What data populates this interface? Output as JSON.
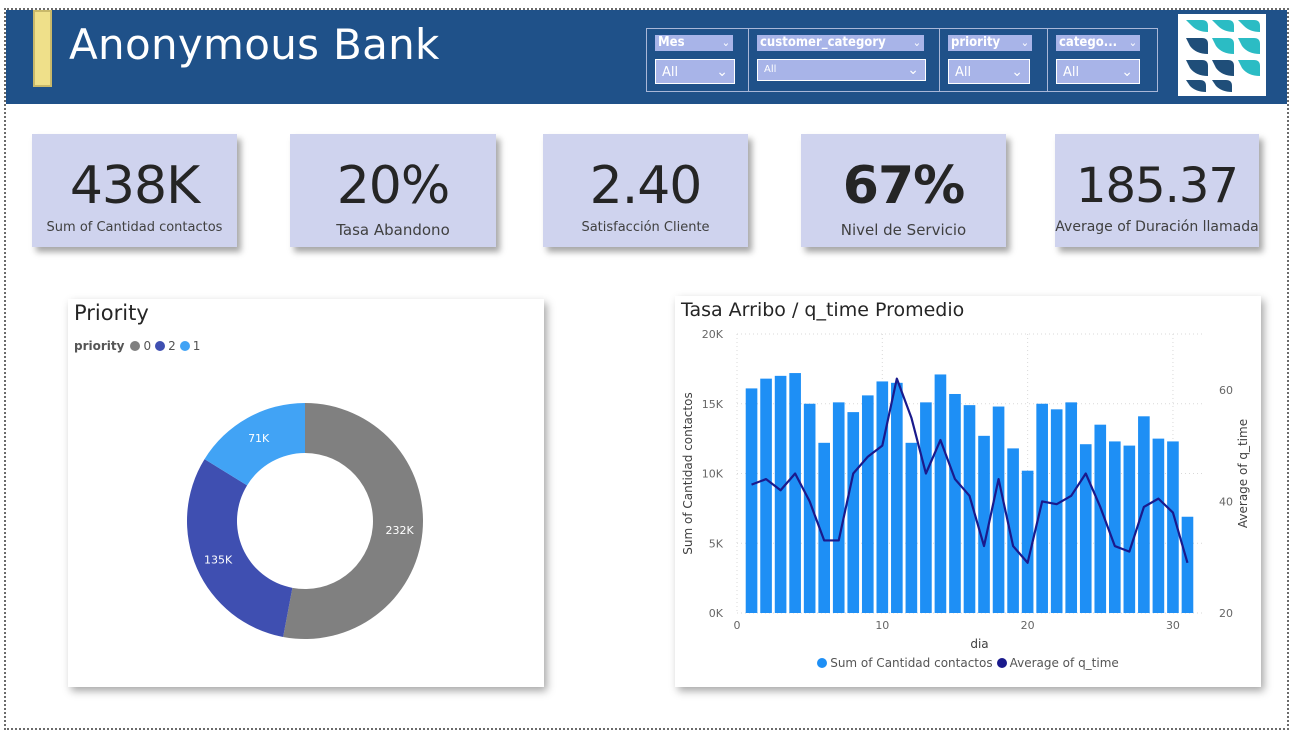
{
  "header": {
    "title": "Anonymous Bank",
    "background": "#1f5189",
    "accent": "#efe08a"
  },
  "slicers": [
    {
      "title": "Mes",
      "value": "All"
    },
    {
      "title": "customer_category",
      "value": "All"
    },
    {
      "title": "priority",
      "value": "All"
    },
    {
      "title": "catego...",
      "value": "All"
    }
  ],
  "logo": {
    "icon": "bank-logo-icon",
    "colors": [
      "#1f4e79",
      "#2bbcc4"
    ]
  },
  "kpis": [
    {
      "value": "438K",
      "label": "Sum of Cantidad contactos"
    },
    {
      "value": "20%",
      "label": "Tasa Abandono"
    },
    {
      "value": "2.40",
      "label": "Satisfacción Cliente"
    },
    {
      "value": "67%",
      "label": "Nivel de Servicio"
    },
    {
      "value": "185.37",
      "label": "Average of Duración llamada"
    }
  ],
  "priority_chart": {
    "title": "Priority",
    "legend_title": "priority"
  },
  "arrival_chart": {
    "title": "Tasa Arribo / q_time Promedio"
  },
  "chart_data": [
    {
      "type": "pie",
      "title": "Priority",
      "legend_title": "priority",
      "slices": [
        {
          "name": "0",
          "label": "232K",
          "value": 232,
          "color": "#808080"
        },
        {
          "name": "2",
          "label": "135K",
          "value": 135,
          "color": "#3f4fb1"
        },
        {
          "name": "1",
          "label": "71K",
          "value": 71,
          "color": "#41a3f5"
        }
      ]
    },
    {
      "type": "bar",
      "title": "Tasa Arribo / q_time Promedio",
      "xlabel": "dia",
      "ylabel": "Sum of Cantidad contactos",
      "y2label": "Average of q_time",
      "xlim": [
        0,
        32
      ],
      "ylim": [
        0,
        20000
      ],
      "y2lim": [
        20,
        70
      ],
      "x_ticks": [
        "0",
        "10",
        "20",
        "30"
      ],
      "y_ticks": [
        "0K",
        "5K",
        "10K",
        "15K",
        "20K"
      ],
      "y2_ticks": [
        "20",
        "40",
        "60"
      ],
      "grid": true,
      "legend_position": "bottom",
      "x": [
        1,
        2,
        3,
        4,
        5,
        6,
        7,
        8,
        9,
        10,
        11,
        12,
        13,
        14,
        15,
        16,
        17,
        18,
        19,
        20,
        21,
        22,
        23,
        24,
        25,
        26,
        27,
        28,
        29,
        30,
        31
      ],
      "series": [
        {
          "name": "Sum of Cantidad contactos",
          "kind": "bar",
          "axis": "left",
          "color": "#1e8ff5",
          "values": [
            16100,
            16800,
            17000,
            17200,
            15000,
            12200,
            15100,
            14400,
            15600,
            16600,
            16500,
            12200,
            15100,
            17100,
            15700,
            14900,
            12700,
            14800,
            11800,
            10200,
            15000,
            14600,
            15100,
            12100,
            13500,
            12300,
            12000,
            14100,
            12500,
            12300,
            6900
          ]
        },
        {
          "name": "Average of q_time",
          "kind": "line",
          "axis": "right",
          "color": "#1a1a8c",
          "values": [
            43,
            44,
            42,
            45,
            40,
            33,
            33,
            45,
            48,
            50,
            62,
            55,
            45,
            51,
            44,
            41,
            32,
            44,
            32,
            29,
            40,
            39.5,
            41,
            45,
            39,
            32,
            31,
            39,
            40.5,
            38,
            29
          ]
        }
      ]
    }
  ]
}
